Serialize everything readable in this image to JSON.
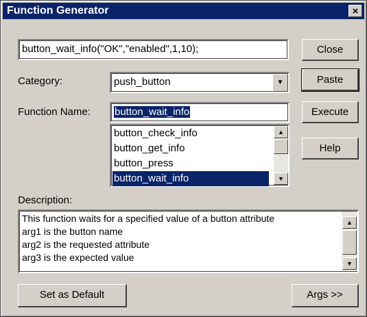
{
  "window": {
    "title": "Function Generator",
    "close_glyph": "×"
  },
  "command_field": {
    "value": "button_wait_info(\"OK\",\"enabled\",1,10);"
  },
  "category": {
    "label": "Category:",
    "selected": "push_button"
  },
  "function_name": {
    "label": "Function Name:",
    "value": "button_wait_info",
    "list": [
      {
        "label": "button_check_info",
        "selected": false
      },
      {
        "label": "button_get_info",
        "selected": false
      },
      {
        "label": "button_press",
        "selected": false
      },
      {
        "label": "button_wait_info",
        "selected": true
      }
    ]
  },
  "description": {
    "label": "Description:",
    "lines": [
      "This function waits for a specified value of a button attribute",
      " arg1 is the button name",
      " arg2 is the requested attribute",
      " arg3 is the expected value"
    ]
  },
  "buttons": {
    "close": "Close",
    "paste": "Paste",
    "execute": "Execute",
    "help": "Help",
    "set_default": "Set as Default",
    "args": "Args >>"
  },
  "icons": {
    "dropdown": "triangle-down",
    "scroll_up": "triangle-up",
    "scroll_down": "triangle-down"
  },
  "colors": {
    "titlebar": "#0a246a",
    "selection": "#0a246a",
    "face": "#d4d0c8"
  }
}
